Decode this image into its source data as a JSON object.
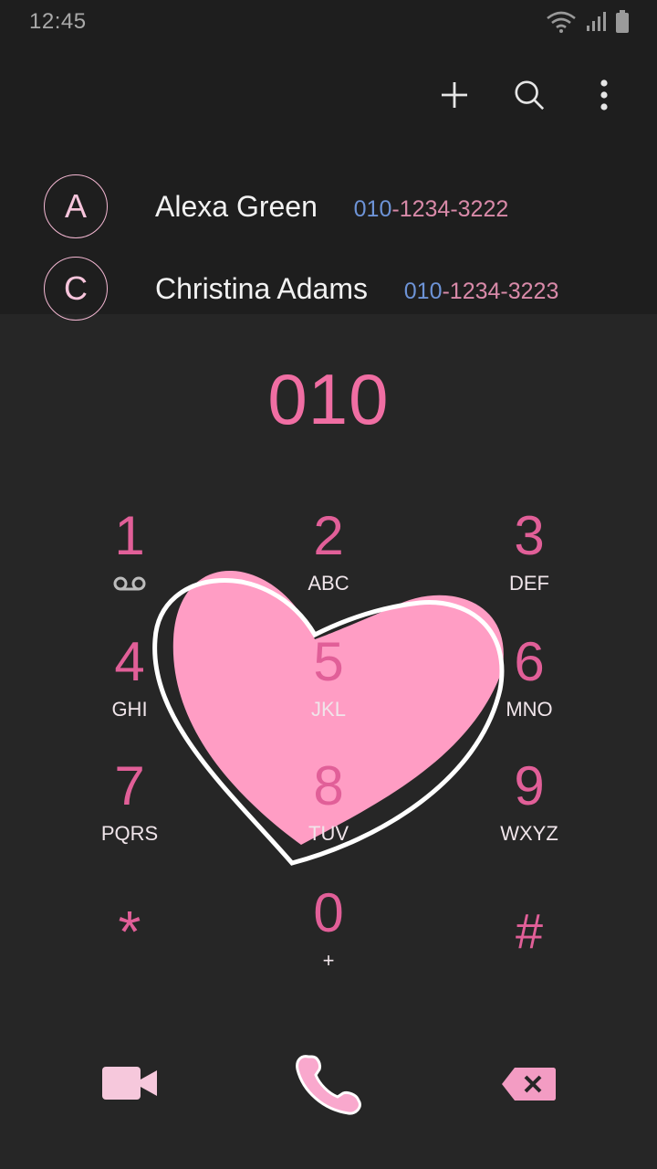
{
  "status_bar": {
    "time": "12:45",
    "icons": [
      "wifi-icon",
      "signal-icon",
      "battery-icon"
    ]
  },
  "toolbar": {
    "icons": [
      "add-icon",
      "search-icon",
      "more-options-icon"
    ]
  },
  "suggestions": [
    {
      "initial": "A",
      "name": "Alexa Green",
      "number_match": "010",
      "number_rest": "-1234-3222"
    },
    {
      "initial": "C",
      "name": "Christina Adams",
      "number_match": "010",
      "number_rest": "-1234-3223"
    }
  ],
  "dialed_number": "010",
  "keypad": [
    {
      "digit": "1",
      "letters": ""
    },
    {
      "digit": "2",
      "letters": "ABC"
    },
    {
      "digit": "3",
      "letters": "DEF"
    },
    {
      "digit": "4",
      "letters": "GHI"
    },
    {
      "digit": "5",
      "letters": "JKL"
    },
    {
      "digit": "6",
      "letters": "MNO"
    },
    {
      "digit": "7",
      "letters": "PQRS"
    },
    {
      "digit": "8",
      "letters": "TUV"
    },
    {
      "digit": "9",
      "letters": "WXYZ"
    },
    {
      "digit": "*",
      "letters": ""
    },
    {
      "digit": "0",
      "letters": "+"
    },
    {
      "digit": "#",
      "letters": ""
    }
  ],
  "actions": {
    "icons": [
      "video-call-icon",
      "call-icon",
      "backspace-icon"
    ]
  },
  "colors": {
    "accent": "#e15f98",
    "heart": "#ff9dc4",
    "avatar_border": "#f3b7d2",
    "match": "#6d93d6"
  }
}
